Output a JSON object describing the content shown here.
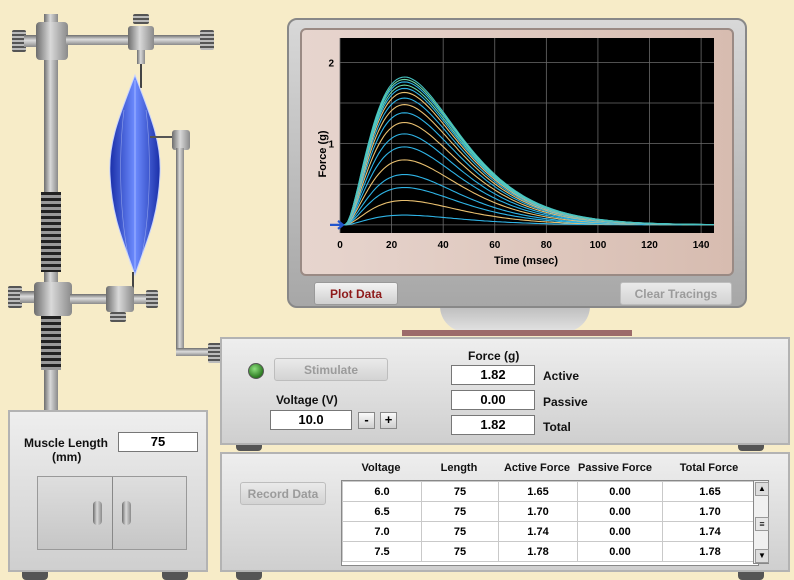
{
  "chart_data": {
    "type": "line",
    "xlabel": "Time (msec)",
    "ylabel": "Force (g)",
    "xlim": [
      0,
      145
    ],
    "ylim": [
      -0.1,
      2.3
    ],
    "xticks": [
      0,
      20,
      40,
      60,
      80,
      100,
      120,
      140
    ],
    "yticks": [
      1,
      2
    ],
    "grid": true,
    "series": [
      {
        "peak": 0.12,
        "color": "#2fb4e6"
      },
      {
        "peak": 0.3,
        "color": "#e9c070"
      },
      {
        "peak": 0.46,
        "color": "#2fb4e6"
      },
      {
        "peak": 0.62,
        "color": "#2fb4e6"
      },
      {
        "peak": 0.8,
        "color": "#e9c070"
      },
      {
        "peak": 0.96,
        "color": "#2fb4e6"
      },
      {
        "peak": 1.12,
        "color": "#2fb4e6"
      },
      {
        "peak": 1.26,
        "color": "#e9c070"
      },
      {
        "peak": 1.38,
        "color": "#2fb4e6"
      },
      {
        "peak": 1.48,
        "color": "#e9c070"
      },
      {
        "peak": 1.56,
        "color": "#2fb4e6"
      },
      {
        "peak": 1.63,
        "color": "#e9c070"
      },
      {
        "peak": 1.68,
        "color": "#2fb4e6"
      },
      {
        "peak": 1.72,
        "color": "#6ad6a6"
      },
      {
        "peak": 1.76,
        "color": "#2fb4e6"
      },
      {
        "peak": 1.79,
        "color": "#6ad6a6"
      },
      {
        "peak": 1.82,
        "color": "#46c2c2"
      }
    ]
  },
  "monitor": {
    "plot_data_label": "Plot Data",
    "clear_tracings_label": "Clear Tracings"
  },
  "controls": {
    "stimulate_label": "Stimulate",
    "voltage_label": "Voltage (V)",
    "voltage_value": "10.0",
    "minus_label": "-",
    "plus_label": "+",
    "force_header": "Force (g)",
    "active_value": "1.82",
    "active_label": "Active",
    "passive_value": "0.00",
    "passive_label": "Passive",
    "total_value": "1.82",
    "total_label": "Total"
  },
  "cabinet": {
    "muscle_length_label": "Muscle Length",
    "muscle_length_unit": "(mm)",
    "muscle_length_value": "75"
  },
  "record": {
    "record_label": "Record Data",
    "headers": [
      "Voltage",
      "Length",
      "Active Force",
      "Passive Force",
      "Total Force"
    ],
    "rows": [
      [
        "6.0",
        "75",
        "1.65",
        "0.00",
        "1.65"
      ],
      [
        "6.5",
        "75",
        "1.70",
        "0.00",
        "1.70"
      ],
      [
        "7.0",
        "75",
        "1.74",
        "0.00",
        "1.74"
      ],
      [
        "7.5",
        "75",
        "1.78",
        "0.00",
        "1.78"
      ]
    ],
    "scroll_up": "▲",
    "scroll_down": "▼",
    "scroll_grip": "≡"
  },
  "colors": {
    "plot_bg": "#000000",
    "muscle": "#2f5fe0",
    "stimulus_marker": "#2255cc"
  }
}
